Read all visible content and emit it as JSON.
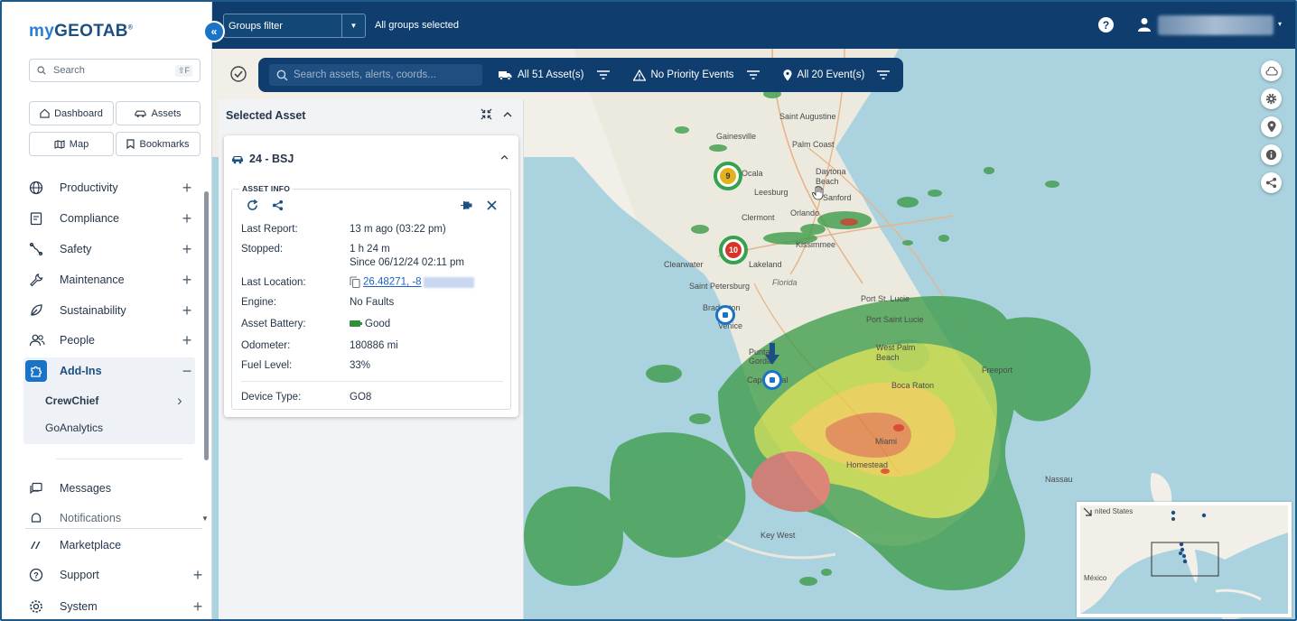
{
  "app": {
    "logo_prefix": "my",
    "logo_suffix": "GEOTAB",
    "logo_tm": "®"
  },
  "sidebar": {
    "search_label": "Search",
    "search_shortcut": "⇧F",
    "quick_buttons": [
      {
        "label": "Dashboard",
        "icon": "home-icon"
      },
      {
        "label": "Assets",
        "icon": "car-icon"
      },
      {
        "label": "Map",
        "icon": "map-icon"
      },
      {
        "label": "Bookmarks",
        "icon": "bookmark-icon"
      }
    ],
    "nav": [
      {
        "label": "Productivity",
        "icon": "globe-icon",
        "toggle": "+"
      },
      {
        "label": "Compliance",
        "icon": "clipboard-icon",
        "toggle": "+"
      },
      {
        "label": "Safety",
        "icon": "road-icon",
        "toggle": "+"
      },
      {
        "label": "Maintenance",
        "icon": "wrench-icon",
        "toggle": "+"
      },
      {
        "label": "Sustainability",
        "icon": "leaf-icon",
        "toggle": "+"
      },
      {
        "label": "People",
        "icon": "people-icon",
        "toggle": "+"
      },
      {
        "label": "Add-Ins",
        "icon": "puzzle-icon",
        "toggle": "−"
      }
    ],
    "addins": [
      {
        "label": "CrewChief",
        "chevron": "›"
      },
      {
        "label": "GoAnalytics"
      }
    ],
    "bottom_nav": [
      {
        "label": "Messages",
        "icon": "message-icon"
      },
      {
        "label": "Notifications",
        "icon": "bell-icon"
      },
      {
        "label": "Marketplace",
        "icon": "marketplace-icon"
      },
      {
        "label": "Support",
        "icon": "help-circle-icon",
        "toggle": "+"
      },
      {
        "label": "System",
        "icon": "gear-icon",
        "toggle": "+"
      }
    ],
    "collapse_glyph": "«"
  },
  "topbar": {
    "groups_filter_label": "Groups filter",
    "groups_status": "All groups selected",
    "help_glyph": "?",
    "user_caret": "▾"
  },
  "map_toolbar": {
    "search_placeholder": "Search assets, alerts, coords...",
    "assets_label": "All 51 Asset(s)",
    "priority_label": "No Priority Events",
    "events_label": "All 20 Event(s)"
  },
  "selected_asset": {
    "panel_title": "Selected Asset",
    "asset_name": "24 - BSJ",
    "section_title": "ASSET INFO",
    "rows": [
      {
        "label": "Last Report:",
        "value": "13 m ago (03:22 pm)"
      },
      {
        "label": "Stopped:",
        "value": "1 h 24 m",
        "value2": "Since 06/12/24 02:11 pm"
      },
      {
        "label": "Last Location:",
        "value": "26.48271, -8"
      },
      {
        "label": "Engine:",
        "value": "No Faults"
      },
      {
        "label": "Asset Battery:",
        "value": "Good"
      },
      {
        "label": "Odometer:",
        "value": "180886 mi"
      },
      {
        "label": "Fuel Level:",
        "value": "33%"
      },
      {
        "label": "Device Type:",
        "value": "GO8"
      }
    ]
  },
  "clusters": [
    {
      "count": "9",
      "color": "#e3b21d"
    },
    {
      "count": "10",
      "color": "#d7352a"
    }
  ],
  "map_places": [
    "Saint Augustine",
    "Palm Coast",
    "Gainesville",
    "Ocala",
    "Daytona Beach",
    "Leesburg",
    "Sanford",
    "Clermont",
    "Orlando",
    "Kissimmee",
    "Clearwater",
    "Lakeland",
    "Saint Petersburg",
    "Florida",
    "Bradenton",
    "Venice",
    "Port St. Lucie",
    "Port Saint Lucie",
    "West Palm Beach",
    "Boca Raton",
    "Punta Gorda",
    "Cape Coral",
    "Miami",
    "Homestead",
    "Nassau",
    "Key West",
    "Freeport"
  ],
  "minimap": {
    "label_us": "nited States",
    "label_mx": "México"
  },
  "colors": {
    "brand_dark": "#0f3e6e",
    "brand_blue": "#1a74c6",
    "good_green": "#2f8f3b"
  }
}
